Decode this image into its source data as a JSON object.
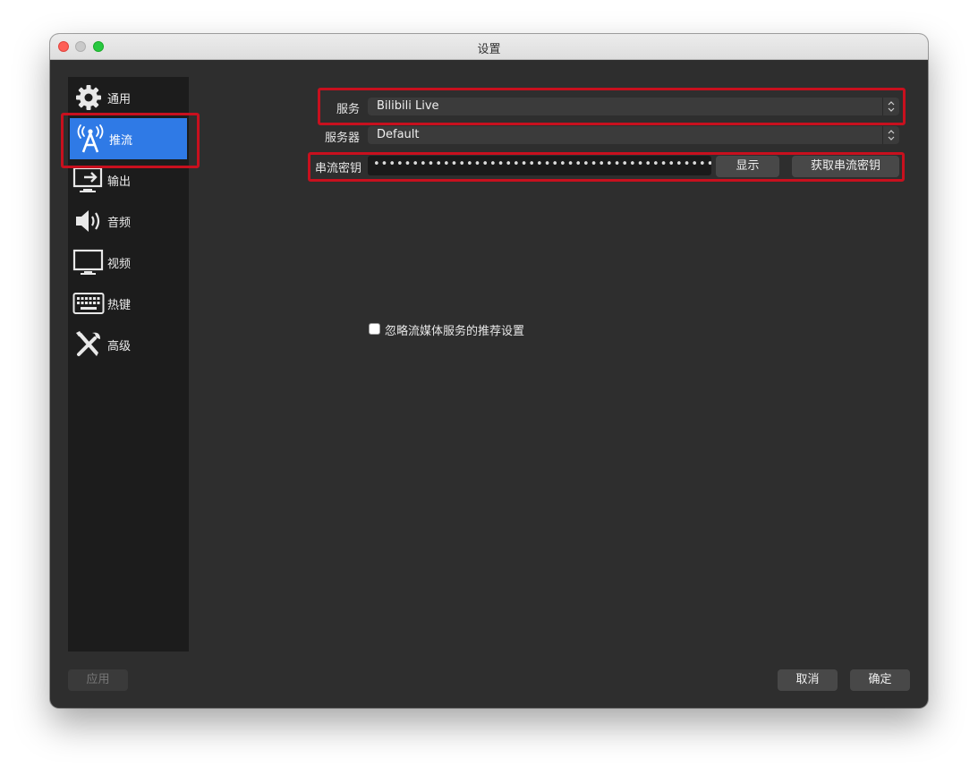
{
  "window": {
    "title": "设置"
  },
  "sidebar": {
    "items": [
      {
        "label": "通用",
        "icon": "gear-icon"
      },
      {
        "label": "推流",
        "icon": "broadcast-antenna-icon",
        "active": true
      },
      {
        "label": "输出",
        "icon": "output-monitor-icon"
      },
      {
        "label": "音频",
        "icon": "speaker-icon"
      },
      {
        "label": "视频",
        "icon": "monitor-icon"
      },
      {
        "label": "热键",
        "icon": "keyboard-icon"
      },
      {
        "label": "高级",
        "icon": "tools-icon"
      }
    ]
  },
  "stream": {
    "service_label": "服务",
    "service_value": "Bilibili Live",
    "server_label": "服务器",
    "server_value": "Default",
    "key_label": "串流密钥",
    "key_value": "••••••••••••••••••••••••••••••••••••••••••••••••••••••",
    "show_button": "显示",
    "get_key_button": "获取串流密钥",
    "ignore_checkbox_label": "忽略流媒体服务的推荐设置",
    "ignore_checked": false
  },
  "footer": {
    "apply": "应用",
    "cancel": "取消",
    "ok": "确定"
  },
  "colors": {
    "accent": "#2f7ae6",
    "highlight": "#c8101e",
    "window_bg": "#2e2e2e",
    "sidebar_bg": "#1c1c1c"
  }
}
